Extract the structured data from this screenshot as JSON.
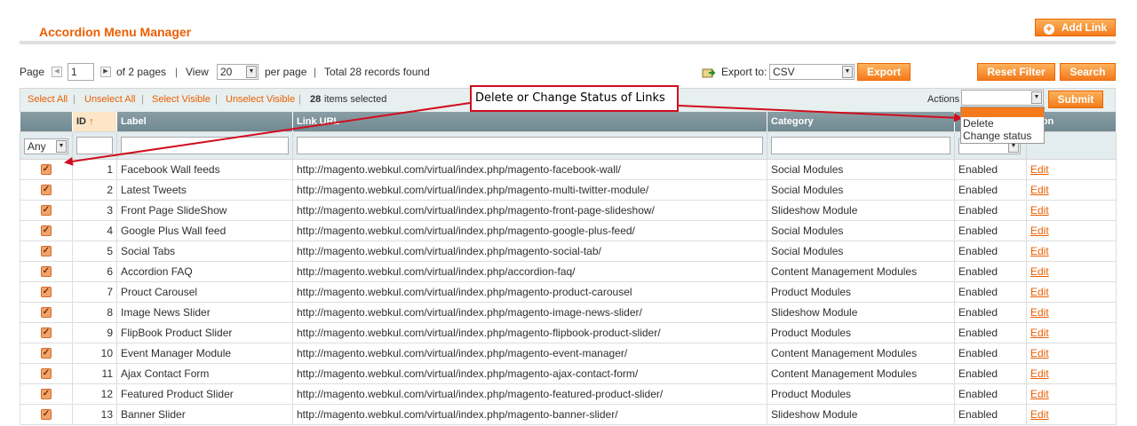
{
  "header": {
    "title": "Accordion Menu Manager",
    "add_link_label": "Add Link"
  },
  "pager": {
    "page_label": "Page",
    "page_value": "1",
    "of_pages": "of 2 pages",
    "view_label": "View",
    "view_value": "20",
    "per_page": "per page",
    "total": "Total 28 records found",
    "sep": "|"
  },
  "export": {
    "label": "Export to:",
    "format": "CSV",
    "button": "Export"
  },
  "filters": {
    "reset": "Reset Filter",
    "search": "Search"
  },
  "massaction": {
    "select_all": "Select All",
    "unselect_all": "Unselect All",
    "select_visible": "Select Visible",
    "unselect_visible": "Unselect Visible",
    "sep": "|",
    "count": "28",
    "items_selected": "items selected",
    "actions_label": "Actions",
    "actions_value": "",
    "submit": "Submit",
    "options": [
      "Delete",
      "Change status"
    ]
  },
  "callout": "Delete or Change Status of Links",
  "columns": {
    "id": "ID",
    "label": "Label",
    "url": "Link URL",
    "category": "Category",
    "action": "ation"
  },
  "filter_row": {
    "any": "Any"
  },
  "rows": [
    {
      "id": "1",
      "label": "Facebook Wall feeds",
      "url": "http://magento.webkul.com/virtual/index.php/magento-facebook-wall/",
      "category": "Social Modules",
      "status": "Enabled",
      "action": "Edit"
    },
    {
      "id": "2",
      "label": "Latest Tweets",
      "url": "http://magento.webkul.com/virtual/index.php/magento-multi-twitter-module/",
      "category": "Social Modules",
      "status": "Enabled",
      "action": "Edit"
    },
    {
      "id": "3",
      "label": "Front Page SlideShow",
      "url": "http://magento.webkul.com/virtual/index.php/magento-front-page-slideshow/",
      "category": "Slideshow Module",
      "status": "Enabled",
      "action": "Edit"
    },
    {
      "id": "4",
      "label": "Google Plus Wall feed",
      "url": "http://magento.webkul.com/virtual/index.php/magento-google-plus-feed/",
      "category": "Social Modules",
      "status": "Enabled",
      "action": "Edit"
    },
    {
      "id": "5",
      "label": "Social Tabs",
      "url": "http://magento.webkul.com/virtual/index.php/magento-social-tab/",
      "category": "Social Modules",
      "status": "Enabled",
      "action": "Edit"
    },
    {
      "id": "6",
      "label": "Accordion FAQ",
      "url": "http://magento.webkul.com/virtual/index.php/accordion-faq/",
      "category": "Content Management Modules",
      "status": "Enabled",
      "action": "Edit"
    },
    {
      "id": "7",
      "label": "Prouct Carousel",
      "url": "http://magento.webkul.com/virtual/index.php/magento-product-carousel",
      "category": "Product Modules",
      "status": "Enabled",
      "action": "Edit"
    },
    {
      "id": "8",
      "label": "Image News Slider",
      "url": "http://magento.webkul.com/virtual/index.php/magento-image-news-slider/",
      "category": "Slideshow Module",
      "status": "Enabled",
      "action": "Edit"
    },
    {
      "id": "9",
      "label": "FlipBook Product Slider",
      "url": "http://magento.webkul.com/virtual/index.php/magento-flipbook-product-slider/",
      "category": "Product Modules",
      "status": "Enabled",
      "action": "Edit"
    },
    {
      "id": "10",
      "label": "Event Manager Module",
      "url": "http://magento.webkul.com/virtual/index.php/magento-event-manager/",
      "category": "Content Management Modules",
      "status": "Enabled",
      "action": "Edit"
    },
    {
      "id": "11",
      "label": "Ajax Contact Form",
      "url": "http://magento.webkul.com/virtual/index.php/magento-ajax-contact-form/",
      "category": "Content Management Modules",
      "status": "Enabled",
      "action": "Edit"
    },
    {
      "id": "12",
      "label": "Featured Product Slider",
      "url": "http://magento.webkul.com/virtual/index.php/magento-featured-product-slider/",
      "category": "Product Modules",
      "status": "Enabled",
      "action": "Edit"
    },
    {
      "id": "13",
      "label": "Banner Slider",
      "url": "http://magento.webkul.com/virtual/index.php/magento-banner-slider/",
      "category": "Slideshow Module",
      "status": "Enabled",
      "action": "Edit"
    }
  ],
  "colors": {
    "accent": "#eb5e00",
    "button": "#f47a1b",
    "callout_border": "#d00e1e",
    "header_bg": "#6f8992"
  }
}
